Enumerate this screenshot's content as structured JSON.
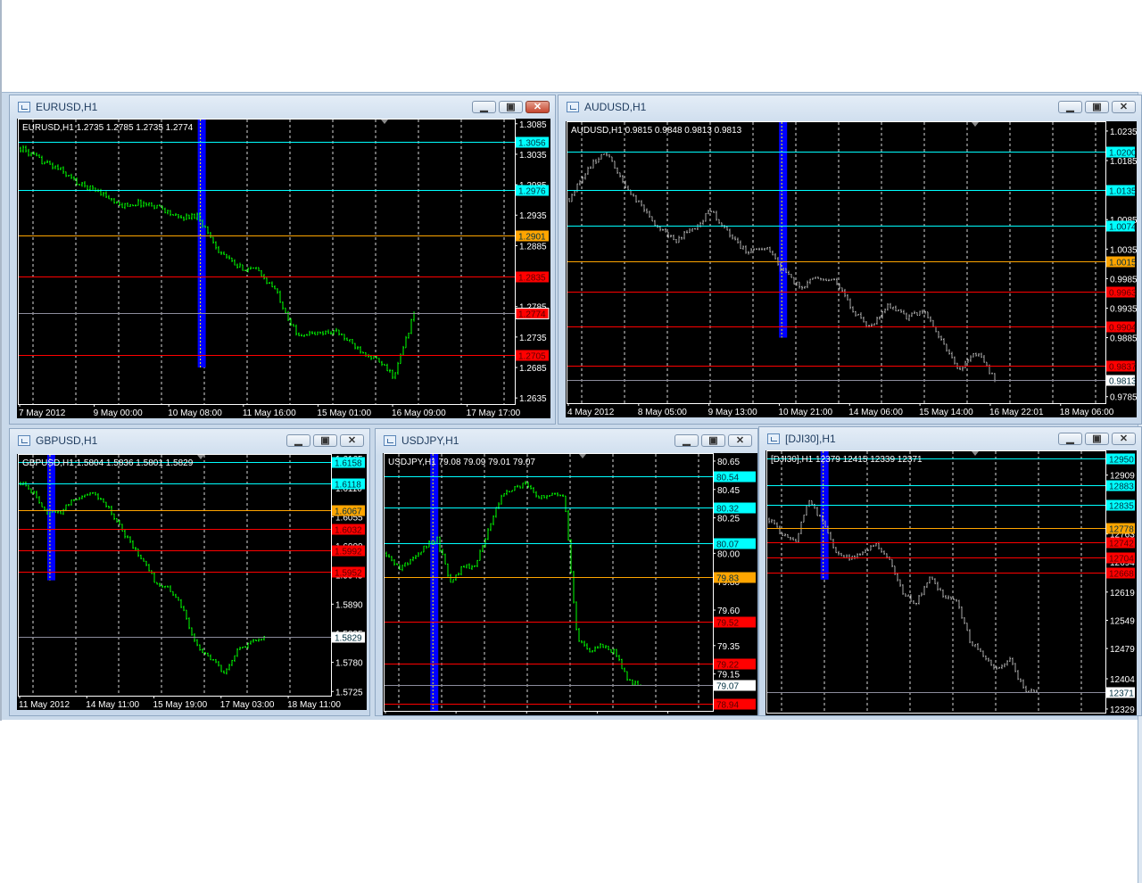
{
  "charts": [
    {
      "id": "eurusd",
      "window_title": "EURUSD,H1",
      "active": true,
      "info": "EURUSD,H1  1.2735 1.2785 1.2735 1.2774",
      "bar_color": "#00ff00",
      "ylim": [
        1.2625,
        1.3092
      ],
      "price_ticks": [
        "1.3085",
        "1.3035",
        "1.2985",
        "1.2935",
        "1.2885",
        "1.2785",
        "1.2735",
        "1.2685",
        "1.2635"
      ],
      "levels": [
        {
          "price": "1.3056",
          "type": "resistance"
        },
        {
          "price": "1.2976",
          "type": "resistance"
        },
        {
          "price": "1.2901",
          "type": "pivot"
        },
        {
          "price": "1.2835",
          "type": "support"
        },
        {
          "price": "1.2705",
          "type": "support"
        },
        {
          "price": "1.2774",
          "type": "bid_red"
        }
      ],
      "time_labels": [
        "7 May 2012",
        "9 May 00:00",
        "10 May 08:00",
        "11 May 16:00",
        "15 May 01:00",
        "16 May 09:00",
        "17 May 17:00"
      ],
      "closes": [
        1.3045,
        1.3025,
        1.301,
        1.2985,
        1.2975,
        1.295,
        1.2955,
        1.295,
        1.293,
        1.2935,
        1.288,
        1.285,
        1.2845,
        1.281,
        1.274,
        1.274,
        1.2745,
        1.272,
        1.27,
        1.267,
        1.2774
      ],
      "empty_right_fraction": 0.2,
      "period_marker": {
        "bar_fraction": 0.46,
        "low": 1.2685
      }
    },
    {
      "id": "audusd",
      "window_title": "AUDUSD,H1",
      "active": false,
      "info": "AUDUSD,H1  0.9815 0.9848 0.9813 0.9813",
      "bar_color": "#a8a8a8",
      "ylim": [
        0.9774,
        1.025
      ],
      "price_ticks": [
        "1.0235",
        "1.0185",
        "1.0085",
        "1.0035",
        "0.9985",
        "0.9935",
        "0.9885",
        "0.9785"
      ],
      "levels": [
        {
          "price": "1.0200",
          "type": "resistance"
        },
        {
          "price": "1.0135",
          "type": "resistance"
        },
        {
          "price": "1.0074",
          "type": "resistance"
        },
        {
          "price": "1.0015",
          "type": "pivot"
        },
        {
          "price": "0.9963",
          "type": "support"
        },
        {
          "price": "0.9904",
          "type": "support"
        },
        {
          "price": "0.9837",
          "type": "support"
        },
        {
          "price": "0.9813",
          "type": "bid"
        }
      ],
      "time_labels": [
        "4 May 2012",
        "8 May 05:00",
        "9 May 13:00",
        "10 May 21:00",
        "14 May 06:00",
        "15 May 14:00",
        "16 May 22:01",
        "18 May 06:00"
      ],
      "closes": [
        1.012,
        1.017,
        1.02,
        1.015,
        1.011,
        1.007,
        1.005,
        1.007,
        1.01,
        1.006,
        1.003,
        1.004,
        1.0,
        0.997,
        0.999,
        0.998,
        0.993,
        0.99,
        0.994,
        0.992,
        0.993,
        0.988,
        0.983,
        0.986,
        0.9813
      ],
      "empty_right_fraction": 0.2,
      "period_marker": {
        "bar_fraction": 0.5,
        "low": 0.9885
      }
    },
    {
      "id": "gbpusd",
      "window_title": "GBPUSD,H1",
      "active": false,
      "info": "GBPUSD,H1  1.5804 1.5836 1.5801 1.5829",
      "bar_color": "#00ff00",
      "ylim": [
        1.5717,
        1.6172
      ],
      "price_ticks": [
        "1.6165",
        "1.6110",
        "1.6055",
        "1.6000",
        "1.5945",
        "1.5890",
        "1.5835",
        "1.5780",
        "1.5725"
      ],
      "levels": [
        {
          "price": "1.6158",
          "type": "resistance"
        },
        {
          "price": "1.6118",
          "type": "resistance"
        },
        {
          "price": "1.6067",
          "type": "pivot"
        },
        {
          "price": "1.6032",
          "type": "support"
        },
        {
          "price": "1.5992",
          "type": "support"
        },
        {
          "price": "1.5952",
          "type": "support"
        },
        {
          "price": "1.5829",
          "type": "bid"
        }
      ],
      "time_labels": [
        "11 May 2012",
        "14 May 11:00",
        "15 May 19:00",
        "17 May 03:00",
        "18 May 11:00"
      ],
      "closes": [
        1.612,
        1.61,
        1.606,
        1.6065,
        1.609,
        1.61,
        1.609,
        1.605,
        1.601,
        1.5975,
        1.593,
        1.592,
        1.588,
        1.581,
        1.579,
        1.576,
        1.58,
        1.582,
        1.5829
      ],
      "empty_right_fraction": 0.21,
      "period_marker": {
        "bar_fraction": 0.13,
        "low": 1.5935
      }
    },
    {
      "id": "usdjpy",
      "window_title": "USDJPY,H1",
      "active": false,
      "info": "USDJPY,H1  79.08 79.09 79.01 79.07",
      "bar_color": "#00ff00",
      "ylim": [
        78.89,
        80.7
      ],
      "price_ticks": [
        "80.65",
        "80.45",
        "80.25",
        "80.00",
        "79.80",
        "79.60",
        "79.35",
        "79.15"
      ],
      "levels": [
        {
          "price": "80.54",
          "type": "resistance"
        },
        {
          "price": "80.32",
          "type": "resistance"
        },
        {
          "price": "80.07",
          "type": "resistance"
        },
        {
          "price": "79.83",
          "type": "pivot"
        },
        {
          "price": "79.52",
          "type": "support"
        },
        {
          "price": "79.22",
          "type": "support"
        },
        {
          "price": "78.94",
          "type": "support"
        },
        {
          "price": "79.07",
          "type": "bid"
        }
      ],
      "time_labels": [
        "10 May 2012",
        "14 May 04:00",
        "15 May 12:00",
        "16 May 20:00",
        "18 May 04:00"
      ],
      "closes": [
        80.0,
        79.9,
        79.95,
        80.05,
        80.1,
        79.8,
        79.9,
        79.92,
        80.15,
        80.4,
        80.45,
        80.5,
        80.4,
        80.42,
        80.4,
        79.4,
        79.3,
        79.35,
        79.3,
        79.1,
        79.07
      ],
      "empty_right_fraction": 0.21,
      "period_marker": {
        "bar_fraction": 0.19,
        "low": 78.89
      }
    },
    {
      "id": "dji30",
      "window_title": "[DJI30],H1",
      "active": false,
      "info": "[DJI30],H1  12379 12415 12339 12371",
      "bar_color": "#a8a8a8",
      "ylim": [
        12320,
        12968
      ],
      "price_ticks": [
        "12909",
        "12763",
        "12694",
        "12619",
        "12549",
        "12479",
        "12404",
        "12329"
      ],
      "levels": [
        {
          "price": "12950",
          "type": "resistance"
        },
        {
          "price": "12883",
          "type": "resistance"
        },
        {
          "price": "12835",
          "type": "resistance"
        },
        {
          "price": "12778",
          "type": "pivot"
        },
        {
          "price": "12742",
          "type": "support"
        },
        {
          "price": "12704",
          "type": "support"
        },
        {
          "price": "12668",
          "type": "support"
        },
        {
          "price": "12371",
          "type": "bid"
        }
      ],
      "time_labels": [],
      "closes": [
        12800,
        12760,
        12750,
        12850,
        12790,
        12720,
        12700,
        12720,
        12740,
        12700,
        12620,
        12590,
        12660,
        12610,
        12600,
        12500,
        12460,
        12430,
        12450,
        12380,
        12371
      ],
      "empty_right_fraction": 0.2,
      "period_marker": {
        "bar_fraction": 0.21,
        "low": 12650
      }
    }
  ],
  "colors": {
    "resistance": "#00ffff",
    "pivot": "#ffa500",
    "support": "#ff0000",
    "bid": "#8c8c9c",
    "period": "#0000ff",
    "grid": "#ffffff"
  },
  "window_buttons": {
    "minimize": "▁",
    "maximize": "▣",
    "close": "✕"
  }
}
